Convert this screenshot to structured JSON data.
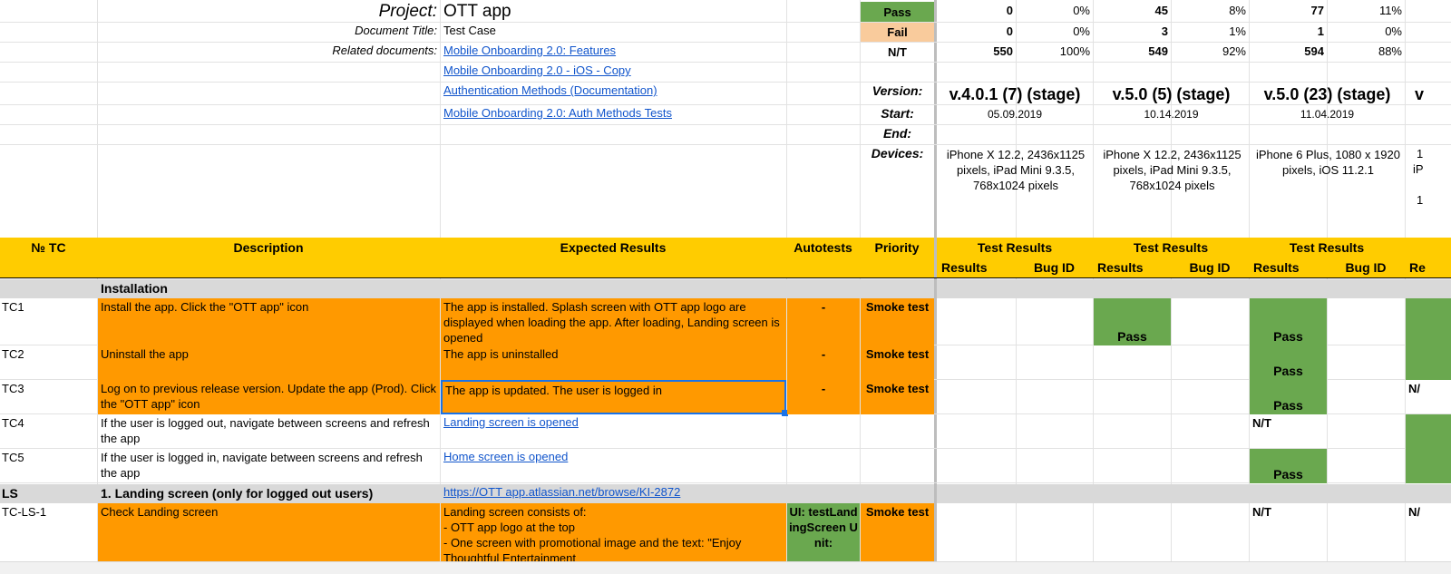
{
  "header": {
    "project_label": "Project:",
    "project_value": "OTT app",
    "doc_title_label": "Document Title:",
    "doc_title_value": "Test Case",
    "related_label": "Related documents:",
    "related_docs": [
      "Mobile Onboarding 2.0: Features",
      "Mobile Onboarding 2.0 - iOS - Copy",
      "Authentication Methods (Documentation)",
      "Mobile Onboarding 2.0: Auth Methods Tests"
    ]
  },
  "summary": {
    "pass_label": "Pass",
    "fail_label": "Fail",
    "nt_label": "N/T",
    "version_label": "Version:",
    "start_label": "Start:",
    "end_label": "End:",
    "devices_label": "Devices:",
    "builds": [
      {
        "pass_count": "0",
        "pass_pct": "0%",
        "fail_count": "0",
        "fail_pct": "0%",
        "nt_count": "550",
        "nt_pct": "100%",
        "version": "v.4.0.1 (7) (stage)",
        "start": "05.09.2019",
        "devices": "iPhone X 12.2, 2436x1125 pixels, iPad Mini 9.3.5, 768x1024 pixels"
      },
      {
        "pass_count": "45",
        "pass_pct": "8%",
        "fail_count": "3",
        "fail_pct": "1%",
        "nt_count": "549",
        "nt_pct": "92%",
        "version": "v.5.0 (5) (stage)",
        "start": "10.14.2019",
        "devices": "iPhone X 12.2, 2436x1125 pixels, iPad Mini 9.3.5, 768x1024 pixels"
      },
      {
        "pass_count": "77",
        "pass_pct": "11%",
        "fail_count": "1",
        "fail_pct": "0%",
        "nt_count": "594",
        "nt_pct": "88%",
        "version": "v.5.0 (23) (stage)",
        "start": "11.04.2019",
        "devices": "iPhone 6 Plus, 1080 x 1920 pixels, iOS 11.2.1"
      }
    ],
    "partial_col": {
      "version": "v",
      "dev1": "1",
      "dev2": "iP",
      "dev3": "1"
    }
  },
  "table_header": {
    "tc": "№ TC",
    "description": "Description",
    "expected": "Expected Results",
    "autotests": "Autotests",
    "priority": "Priority",
    "test_results": "Test Results",
    "results": "Results",
    "bug_id": "Bug ID",
    "results_partial": "Re"
  },
  "sections": {
    "installation": "Installation",
    "ls_id": "LS",
    "ls_title": "1. Landing screen (only for logged out users)",
    "ls_link": "https://OTT app.atlassian.net/browse/KI-2872"
  },
  "rows": [
    {
      "id": "TC1",
      "desc": "Install the app. Click the \"OTT app\" icon",
      "expected": "The app is installed. Splash screen with OTT app logo are displayed when loading the app. After loading, Landing screen is opened",
      "auto": "-",
      "priority": "Smoke test"
    },
    {
      "id": "TC2",
      "desc": "Uninstall the app",
      "expected": "The app is uninstalled",
      "auto": "-",
      "priority": "Smoke test"
    },
    {
      "id": "TC3",
      "desc": "Log on to previous release version. Update the app (Prod). Click the \"OTT app\" icon",
      "expected": "The app is updated. The user is logged in",
      "auto": "-",
      "priority": "Smoke test"
    },
    {
      "id": "TC4",
      "desc": "If the user is logged out, navigate between screens and refresh the app",
      "expected": "Landing screen is opened",
      "auto": "",
      "priority": ""
    },
    {
      "id": "TC5",
      "desc": "If the user is logged in, navigate between screens and refresh the app",
      "expected": "Home screen is opened",
      "auto": "",
      "priority": ""
    },
    {
      "id": "TC-LS-1",
      "desc": "Check Landing screen",
      "expected": "Landing screen consists of:\n- OTT app logo at the top\n- One screen with promotional image and the text: \"Enjoy Thoughtful Entertainment",
      "auto": "UI: testLandingScreen Unit:",
      "priority": "Smoke test"
    }
  ],
  "results": {
    "pass": "Pass",
    "nt": "N/T",
    "nt_partial": "N/"
  }
}
